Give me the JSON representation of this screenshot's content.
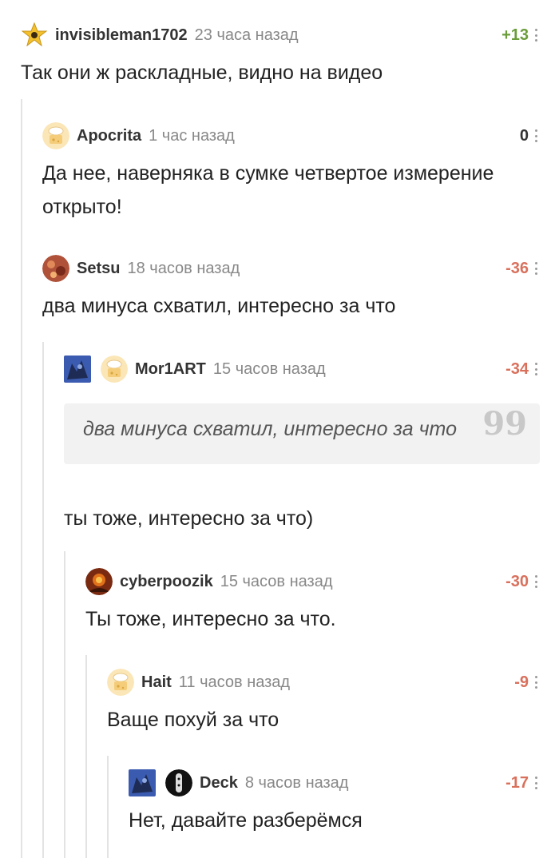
{
  "comments": [
    {
      "username": "invisibleman1702",
      "time": "23 часа назад",
      "rating": "+13",
      "text": "Так они ж раскладные, видно на видео",
      "avatar": "star-icon"
    },
    {
      "username": "Apocrita",
      "time": "1 час назад",
      "rating": "0",
      "text": "Да нее, наверняка в сумке четвертое измерение открыто!",
      "avatar": "default-avatar-icon"
    },
    {
      "username": "Setsu",
      "time": "18 часов назад",
      "rating": "-36",
      "text": "два минуса схватил, интересно за что",
      "avatar": "photo-avatar"
    },
    {
      "username": "Mor1ART",
      "time": "15 часов назад",
      "rating": "-34",
      "quote": "два минуса схватил, интересно за что",
      "quote_mark": "99",
      "text": "ты тоже, интересно за что)",
      "avatar": "default-avatar-icon"
    },
    {
      "username": "cyberpoozik",
      "time": "15 часов назад",
      "rating": "-30",
      "text": "Ты тоже, интересно за что.",
      "avatar": "photo-avatar"
    },
    {
      "username": "Hait",
      "time": "11 часов назад",
      "rating": "-9",
      "text": "Ваще похуй за что",
      "avatar": "default-avatar-icon"
    },
    {
      "username": "Deck",
      "time": "8 часов назад",
      "rating": "-17",
      "text": "Нет, давайте разберёмся",
      "avatar": "photo-avatar"
    }
  ],
  "colors": {
    "positive": "#6a9c3a",
    "negative": "#d9705c",
    "neutral": "#333333",
    "thread_line": "#e3e3e3",
    "quote_bg": "#f2f2f2"
  }
}
